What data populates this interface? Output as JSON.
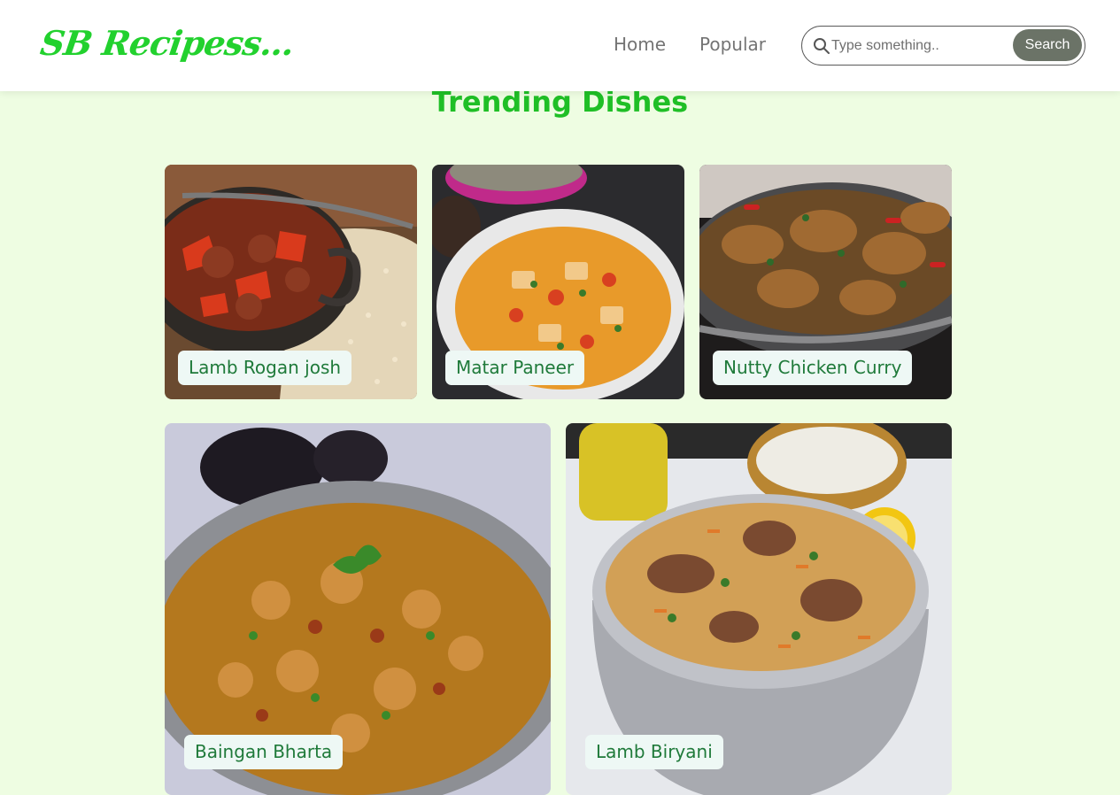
{
  "header": {
    "logo_text": "SB Recipess...",
    "nav": [
      {
        "label": "Home"
      },
      {
        "label": "Popular"
      }
    ],
    "search": {
      "placeholder": "Type something..",
      "value": "",
      "button_label": "Search"
    }
  },
  "main": {
    "title": "Trending Dishes",
    "dishes": [
      {
        "name": "Lamb Rogan josh"
      },
      {
        "name": "Matar Paneer"
      },
      {
        "name": "Nutty Chicken Curry"
      },
      {
        "name": "Baingan Bharta"
      },
      {
        "name": "Lamb Biryani"
      }
    ]
  },
  "colors": {
    "page_bg": "#eefde2",
    "brand_green": "#22d12e",
    "title_green": "#1fbf26",
    "label_text": "#1f7a3a",
    "search_button": "#6b7367"
  },
  "icons": {
    "search": "search-icon"
  }
}
